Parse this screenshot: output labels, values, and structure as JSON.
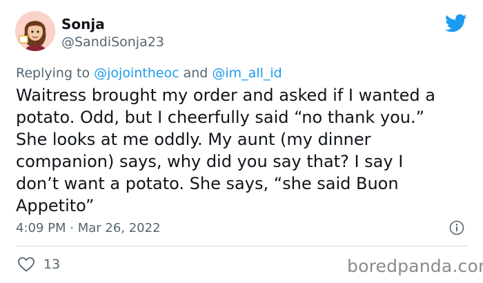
{
  "author": {
    "name": "Sonja",
    "handle": "@SandiSonja23"
  },
  "reply": {
    "prefix": "Replying to ",
    "mention_1": "@jojointheoc",
    "joiner": " and ",
    "mention_2": "@im_all_id"
  },
  "tweet": {
    "lines": [
      "Waitress brought my order and asked if I wanted a",
      "potato. Odd, but I cheerfully said “no thank you.”",
      "She looks at me oddly. My aunt (my dinner",
      "companion) says, why did you say that? I say I",
      "don’t want a potato. She says, “she said Buon",
      "Appetito”"
    ],
    "timestamp": "4:09 PM · Mar 26, 2022"
  },
  "engagement": {
    "likes": "13"
  },
  "watermark": "boredpanda.com",
  "colors": {
    "twitter_blue": "#1d9bf0",
    "secondary_text": "#536471",
    "divider": "#cfd9de"
  },
  "icons": {
    "brand": "twitter-bird-icon",
    "info": "info-icon",
    "like": "heart-icon"
  }
}
